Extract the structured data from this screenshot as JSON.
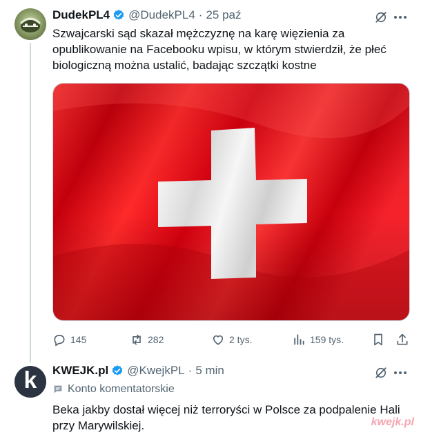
{
  "tweets": [
    {
      "author": {
        "name": "DudekPL4",
        "handle": "@DudekPL4",
        "time": "25 paź"
      },
      "text": "Szwajcarski sąd skazał mężczyznę na karę więzienia za opublikowanie na Facebooku wpisu, w którym stwierdził, że płeć biologiczną można ustalić, badając szczątki kostne",
      "stats": {
        "replies": "145",
        "reposts": "282",
        "likes": "2 tys.",
        "views": "159 tys."
      }
    },
    {
      "author": {
        "name": "KWEJK.pl",
        "handle": "@KwejkPL",
        "time": "5 min",
        "avatar_letter": "k"
      },
      "badge": "Konto komentatorskie",
      "text": "Beka jakby dostał więcej niż terroryści w Polsce za podpalenie Hali przy Marywilskiej."
    }
  ],
  "separator": "·",
  "watermark": "kwejk.pl",
  "colors": {
    "accent": "#1d9bf0",
    "muted": "#536471",
    "flag_red": "#d90e1a"
  },
  "icons": [
    "verified-icon",
    "grok-icon",
    "more-icon",
    "reply-icon",
    "repost-icon",
    "like-icon",
    "views-icon",
    "bookmark-icon",
    "share-icon",
    "community-notes-icon"
  ]
}
